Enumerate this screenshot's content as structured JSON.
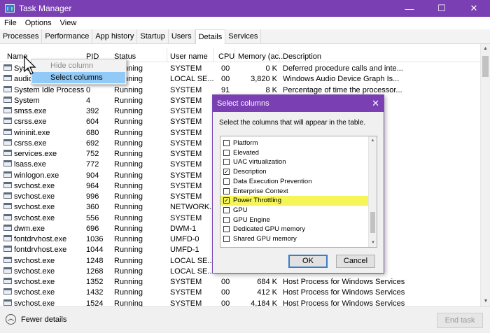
{
  "window": {
    "title": "Task Manager",
    "minimize": "—",
    "maximize": "☐",
    "close": "✕"
  },
  "menu": [
    "File",
    "Options",
    "View"
  ],
  "tabs": [
    "Processes",
    "Performance",
    "App history",
    "Startup",
    "Users",
    "Details",
    "Services"
  ],
  "active_tab": "Details",
  "columns": {
    "name": "Name",
    "pid": "PID",
    "status": "Status",
    "user": "User name",
    "cpu": "CPU",
    "memory": "Memory (ac...",
    "description": "Description"
  },
  "rows": [
    {
      "name": "System...",
      "pid": "",
      "status": "Running",
      "user": "SYSTEM",
      "cpu": "00",
      "mem": "0 K",
      "desc": "Deferred procedure calls and inte..."
    },
    {
      "name": "audio...",
      "pid": "",
      "status": "Running",
      "user": "LOCAL SE...",
      "cpu": "00",
      "mem": "3,820 K",
      "desc": "Windows Audio Device Graph Is..."
    },
    {
      "name": "System Idle Process",
      "pid": "0",
      "status": "Running",
      "user": "SYSTEM",
      "cpu": "91",
      "mem": "8 K",
      "desc": "Percentage of time the processor..."
    },
    {
      "name": "System",
      "pid": "4",
      "status": "Running",
      "user": "SYSTEM",
      "cpu": "",
      "mem": "",
      "desc": ""
    },
    {
      "name": "smss.exe",
      "pid": "392",
      "status": "Running",
      "user": "SYSTEM",
      "cpu": "",
      "mem": "",
      "desc": ""
    },
    {
      "name": "csrss.exe",
      "pid": "604",
      "status": "Running",
      "user": "SYSTEM",
      "cpu": "",
      "mem": "",
      "desc": ""
    },
    {
      "name": "wininit.exe",
      "pid": "680",
      "status": "Running",
      "user": "SYSTEM",
      "cpu": "",
      "mem": "",
      "desc": ""
    },
    {
      "name": "csrss.exe",
      "pid": "692",
      "status": "Running",
      "user": "SYSTEM",
      "cpu": "",
      "mem": "",
      "desc": ""
    },
    {
      "name": "services.exe",
      "pid": "752",
      "status": "Running",
      "user": "SYSTEM",
      "cpu": "",
      "mem": "",
      "desc": ""
    },
    {
      "name": "lsass.exe",
      "pid": "772",
      "status": "Running",
      "user": "SYSTEM",
      "cpu": "",
      "mem": "",
      "desc": ""
    },
    {
      "name": "winlogon.exe",
      "pid": "904",
      "status": "Running",
      "user": "SYSTEM",
      "cpu": "",
      "mem": "",
      "desc": ""
    },
    {
      "name": "svchost.exe",
      "pid": "964",
      "status": "Running",
      "user": "SYSTEM",
      "cpu": "",
      "mem": "",
      "desc": "s"
    },
    {
      "name": "svchost.exe",
      "pid": "996",
      "status": "Running",
      "user": "SYSTEM",
      "cpu": "",
      "mem": "",
      "desc": "s"
    },
    {
      "name": "svchost.exe",
      "pid": "360",
      "status": "Running",
      "user": "NETWORK...",
      "cpu": "",
      "mem": "",
      "desc": "s"
    },
    {
      "name": "svchost.exe",
      "pid": "556",
      "status": "Running",
      "user": "SYSTEM",
      "cpu": "",
      "mem": "",
      "desc": "s"
    },
    {
      "name": "dwm.exe",
      "pid": "696",
      "status": "Running",
      "user": "DWM-1",
      "cpu": "",
      "mem": "",
      "desc": ""
    },
    {
      "name": "fontdrvhost.exe",
      "pid": "1036",
      "status": "Running",
      "user": "UMFD-0",
      "cpu": "",
      "mem": "",
      "desc": ""
    },
    {
      "name": "fontdrvhost.exe",
      "pid": "1044",
      "status": "Running",
      "user": "UMFD-1",
      "cpu": "",
      "mem": "",
      "desc": ""
    },
    {
      "name": "svchost.exe",
      "pid": "1248",
      "status": "Running",
      "user": "LOCAL SE...",
      "cpu": "",
      "mem": "",
      "desc": "s"
    },
    {
      "name": "svchost.exe",
      "pid": "1268",
      "status": "Running",
      "user": "LOCAL SE...",
      "cpu": "",
      "mem": "",
      "desc": "s"
    },
    {
      "name": "svchost.exe",
      "pid": "1352",
      "status": "Running",
      "user": "SYSTEM",
      "cpu": "00",
      "mem": "684 K",
      "desc": "Host Process for Windows Services"
    },
    {
      "name": "svchost.exe",
      "pid": "1432",
      "status": "Running",
      "user": "SYSTEM",
      "cpu": "00",
      "mem": "412 K",
      "desc": "Host Process for Windows Services"
    },
    {
      "name": "svchost.exe",
      "pid": "1524",
      "status": "Running",
      "user": "SYSTEM",
      "cpu": "00",
      "mem": "4,184 K",
      "desc": "Host Process for Windows Services"
    }
  ],
  "context_menu": {
    "hide": "Hide column",
    "select": "Select columns"
  },
  "dialog": {
    "title": "Select columns",
    "close": "✕",
    "description": "Select the columns that will appear in the table.",
    "options": [
      {
        "label": "Platform",
        "checked": false
      },
      {
        "label": "Elevated",
        "checked": false
      },
      {
        "label": "UAC virtualization",
        "checked": false
      },
      {
        "label": "Description",
        "checked": true
      },
      {
        "label": "Data Execution Prevention",
        "checked": false
      },
      {
        "label": "Enterprise Context",
        "checked": false
      },
      {
        "label": "Power Throttling",
        "checked": true,
        "highlighted": true
      },
      {
        "label": "GPU",
        "checked": false
      },
      {
        "label": "GPU Engine",
        "checked": false
      },
      {
        "label": "Dedicated GPU memory",
        "checked": false
      },
      {
        "label": "Shared GPU memory",
        "checked": false
      }
    ],
    "ok": "OK",
    "cancel": "Cancel"
  },
  "footer": {
    "fewer_details": "Fewer details",
    "end_task": "End task"
  },
  "colors": {
    "accent": "#7a3fb3",
    "highlight": "#f5f558",
    "menu_selected": "#91c9f7"
  },
  "icons": [
    "app-icon",
    "process-icon",
    "chevron-up-icon",
    "checkbox-icon",
    "mouse-cursor-icon"
  ]
}
